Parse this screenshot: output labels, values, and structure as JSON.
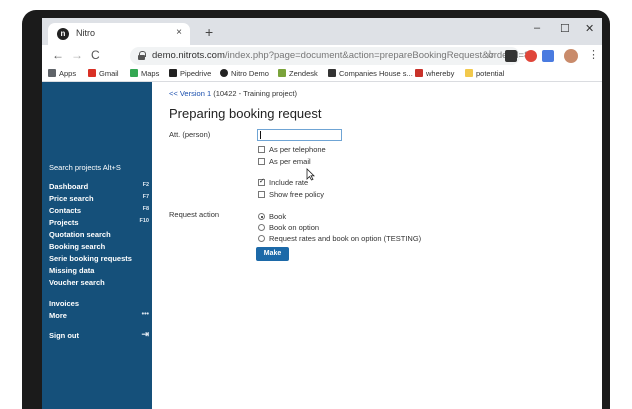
{
  "browser": {
    "tab_title": "Nitro",
    "tab_close": "×",
    "new_tab": "+",
    "minimize": "–",
    "maximize": "☐",
    "close": "✕",
    "back": "←",
    "forward": "→",
    "reload": "C",
    "url_host": "demo.nitrots.com",
    "url_path": "/index.php?page=document&action=prepareBookingRequest&orderId=8...",
    "bookmarks": [
      "Apps",
      "Gmail",
      "Maps",
      "Pipedrive",
      "Nitro Demo",
      "Zendesk",
      "Companies House s...",
      "whereby",
      "potential"
    ]
  },
  "sidebar": {
    "search": "Search projects Alt+S",
    "items": [
      {
        "label": "Dashboard",
        "key": "F2"
      },
      {
        "label": "Price search",
        "key": "F7"
      },
      {
        "label": "Contacts",
        "key": "F8"
      },
      {
        "label": "Projects",
        "key": "F10"
      },
      {
        "label": "Quotation search",
        "key": ""
      },
      {
        "label": "Booking search",
        "key": ""
      },
      {
        "label": "Serie booking requests",
        "key": ""
      },
      {
        "label": "Missing data",
        "key": ""
      },
      {
        "label": "Voucher search",
        "key": ""
      },
      {
        "label": "Invoices",
        "key": ""
      },
      {
        "label": "More",
        "key": "•••"
      },
      {
        "label": "Sign out",
        "key": "⇥"
      }
    ]
  },
  "main": {
    "breadcrumb_link": "<< Version 1",
    "breadcrumb_rest": " (10422 - Training project)",
    "title": "Preparing booking request",
    "att_label": "Att. (person)",
    "att_value": "",
    "checkboxes": [
      {
        "label": "As per telephone",
        "checked": false
      },
      {
        "label": "As per email",
        "checked": false
      },
      {
        "label": "Include rate",
        "checked": true
      },
      {
        "label": "Show free policy",
        "checked": false
      }
    ],
    "request_action_label": "Request action",
    "radios": [
      {
        "label": "Book",
        "checked": true
      },
      {
        "label": "Book on option",
        "checked": false
      },
      {
        "label": "Request rates and book on option (TESTING)",
        "checked": false
      }
    ],
    "make_button": "Make"
  }
}
